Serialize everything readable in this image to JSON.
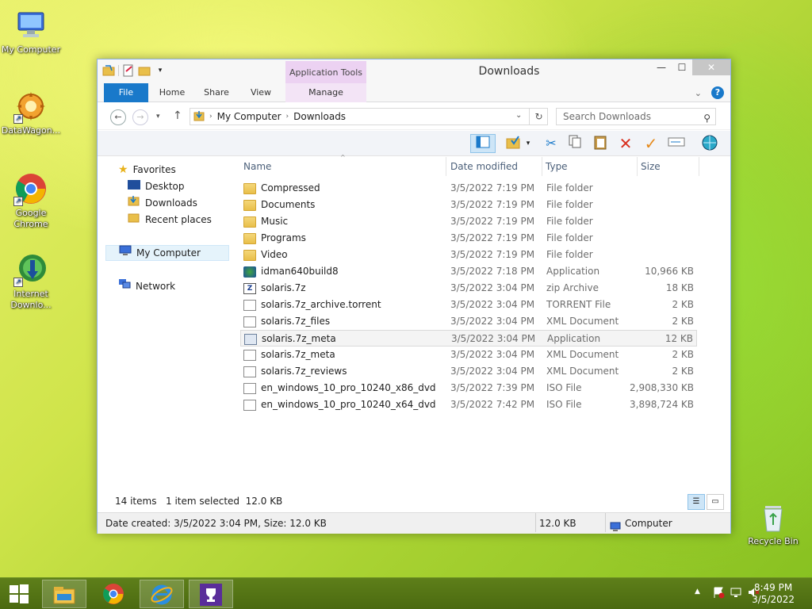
{
  "desktop": {
    "icons": [
      {
        "label": "My Computer",
        "icon": "computer-icon"
      },
      {
        "label": "DataWagon...",
        "icon": "datawagon-icon"
      },
      {
        "label": "Google Chrome",
        "icon": "chrome-icon"
      },
      {
        "label": "Internet Downlo...",
        "icon": "idm-icon"
      },
      {
        "label": "Recycle Bin",
        "icon": "recycle-bin-icon"
      }
    ]
  },
  "window": {
    "title": "Downloads",
    "application_tools": "Application Tools",
    "ribbon_tabs": [
      "File",
      "Home",
      "Share",
      "View",
      "Manage"
    ],
    "address": {
      "root": "My Computer",
      "current": "Downloads"
    },
    "search_placeholder": "Search Downloads"
  },
  "nav_pane": {
    "favorites": "Favorites",
    "favorite_items": [
      "Desktop",
      "Downloads",
      "Recent places"
    ],
    "my_computer": "My Computer",
    "network": "Network"
  },
  "columns": {
    "name": "Name",
    "date": "Date modified",
    "type": "Type",
    "size": "Size"
  },
  "files": [
    {
      "name": "Compressed",
      "date": "3/5/2022 7:19 PM",
      "type": "File folder",
      "size": "",
      "icon": "folder"
    },
    {
      "name": "Documents",
      "date": "3/5/2022 7:19 PM",
      "type": "File folder",
      "size": "",
      "icon": "folder"
    },
    {
      "name": "Music",
      "date": "3/5/2022 7:19 PM",
      "type": "File folder",
      "size": "",
      "icon": "folder"
    },
    {
      "name": "Programs",
      "date": "3/5/2022 7:19 PM",
      "type": "File folder",
      "size": "",
      "icon": "folder"
    },
    {
      "name": "Video",
      "date": "3/5/2022 7:19 PM",
      "type": "File folder",
      "size": "",
      "icon": "folder"
    },
    {
      "name": "idman640build8",
      "date": "3/5/2022 7:18 PM",
      "type": "Application",
      "size": "10,966 KB",
      "icon": "idm"
    },
    {
      "name": "solaris.7z",
      "date": "3/5/2022 3:04 PM",
      "type": "zip Archive",
      "size": "18 KB",
      "icon": "zip"
    },
    {
      "name": "solaris.7z_archive.torrent",
      "date": "3/5/2022 3:04 PM",
      "type": "TORRENT File",
      "size": "2 KB",
      "icon": "doc"
    },
    {
      "name": "solaris.7z_files",
      "date": "3/5/2022 3:04 PM",
      "type": "XML Document",
      "size": "2 KB",
      "icon": "xml"
    },
    {
      "name": "solaris.7z_meta",
      "date": "3/5/2022 3:04 PM",
      "type": "Application",
      "size": "12 KB",
      "icon": "app"
    },
    {
      "name": "solaris.7z_meta",
      "date": "3/5/2022 3:04 PM",
      "type": "XML Document",
      "size": "2 KB",
      "icon": "xml"
    },
    {
      "name": "solaris.7z_reviews",
      "date": "3/5/2022 3:04 PM",
      "type": "XML Document",
      "size": "2 KB",
      "icon": "xml"
    },
    {
      "name": "en_windows_10_pro_10240_x86_dvd",
      "date": "3/5/2022 7:39 PM",
      "type": "ISO File",
      "size": "2,908,330 KB",
      "icon": "iso"
    },
    {
      "name": "en_windows_10_pro_10240_x64_dvd",
      "date": "3/5/2022 7:42 PM",
      "type": "ISO File",
      "size": "3,898,724 KB",
      "icon": "iso"
    }
  ],
  "selected_index": 9,
  "status": {
    "items": "14 items",
    "selected": "1 item selected  12.0 KB",
    "details": "Date created: 3/5/2022 3:04 PM, Size: 12.0 KB",
    "size": "12.0 KB",
    "location": "Computer"
  },
  "taskbar": {
    "items": [
      "file-explorer-icon",
      "chrome-icon",
      "internet-explorer-icon",
      "trophy-icon"
    ],
    "time": "8:49 PM",
    "date": "3/5/2022"
  }
}
